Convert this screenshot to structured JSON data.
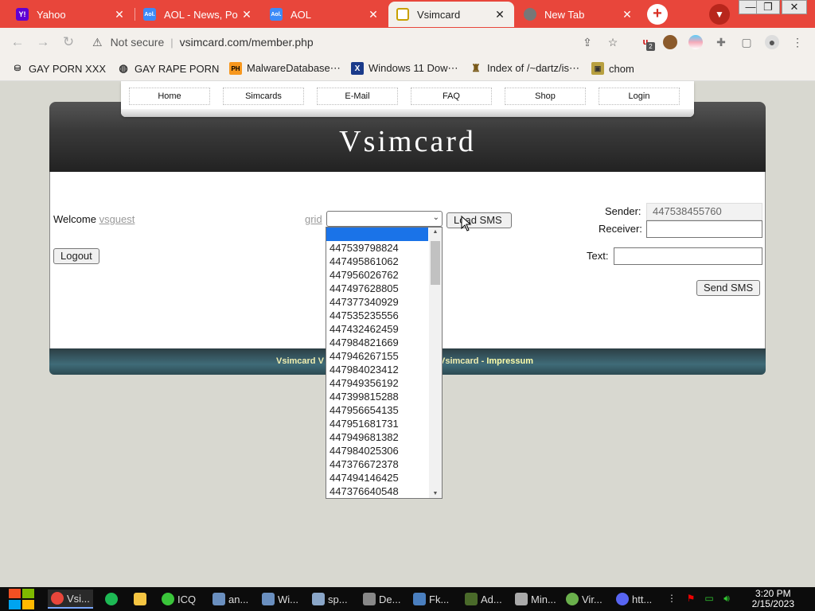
{
  "browser": {
    "tabs": [
      {
        "title": "Yahoo",
        "icon": "yahoo-favicon",
        "icon_label": "Y!",
        "color": "#6001d2"
      },
      {
        "title": "AOL - News, Po",
        "icon": "aol-favicon",
        "icon_label": "Aol.",
        "color": "#3d8af7"
      },
      {
        "title": "AOL",
        "icon": "aol-favicon",
        "icon_label": "Aol.",
        "color": "#3d8af7"
      },
      {
        "title": "Vsimcard",
        "icon": "vsimcard-favicon",
        "icon_label": "",
        "color": "#e0b000"
      },
      {
        "title": "New Tab",
        "icon": "chrome-favicon",
        "icon_label": "",
        "color": "#888888"
      }
    ],
    "new_tab_symbol": "+",
    "address": {
      "security": "Not secure",
      "separator": "|",
      "url": "vsimcard.com/member.php"
    },
    "bookmarks": [
      {
        "label": "GAY PORN XXX",
        "icon": "bookmark-icon"
      },
      {
        "label": "GAY RAPE PORN",
        "icon": "globe-icon"
      },
      {
        "label": "MalwareDatabase⋯",
        "icon": "ph-icon",
        "icon_label": "PH"
      },
      {
        "label": "Windows 11 Dow⋯",
        "icon": "x-icon",
        "icon_label": "X"
      },
      {
        "label": "Index of /~dartz/is⋯",
        "icon": "server-icon"
      },
      {
        "label": "chom",
        "icon": "image-icon"
      }
    ],
    "extension_badge": "2",
    "accent_color": "#e8463b"
  },
  "site": {
    "nav": [
      "Home",
      "Simcards",
      "E-Mail",
      "FAQ",
      "Shop",
      "Login"
    ],
    "logo": "Vsimcard",
    "welcome_label": "Welcome",
    "username": "vsguest",
    "logout_label": "Logout",
    "grid_label": "grid",
    "select_value": "",
    "load_sms_label": "Load SMS",
    "sender_label": "Sender:",
    "sender_value": "447538455760",
    "receiver_label": "Receiver:",
    "receiver_value": "",
    "text_label": "Text:",
    "text_value": "",
    "send_sms_label": "Send SMS",
    "footer_left": "Vsimcard V",
    "footer_right_prefix": "Vsimcard - ",
    "footer_impressum": "Impressum",
    "dropdown_options": [
      "",
      "447539798824",
      "447495861062",
      "447956026762",
      "447497628805",
      "447377340929",
      "447535235556",
      "447432462459",
      "447984821669",
      "447946267155",
      "447984023412",
      "447949356192",
      "447399815288",
      "447956654135",
      "447951681731",
      "447949681382",
      "447984025306",
      "447376672378",
      "447494146425",
      "447376640548"
    ]
  },
  "taskbar": {
    "items": [
      {
        "label": "Vsi...",
        "icon": "chrome-icon",
        "color": "#e8463b"
      },
      {
        "label": "",
        "icon": "spotify-icon",
        "color": "#1db954"
      },
      {
        "label": "",
        "icon": "folder-icon",
        "color": "#f5c542"
      },
      {
        "label": "ICQ",
        "icon": "icq-icon",
        "color": "#3ac53a"
      },
      {
        "label": "an...",
        "icon": "app-icon",
        "color": "#6a8fbf"
      },
      {
        "label": "Wi...",
        "icon": "app-icon",
        "color": "#6a8fbf"
      },
      {
        "label": "sp...",
        "icon": "app-icon",
        "color": "#8aa6c8"
      },
      {
        "label": "De...",
        "icon": "app-icon",
        "color": "#888888"
      },
      {
        "label": "Fk...",
        "icon": "app-icon",
        "color": "#4a7fbf"
      },
      {
        "label": "Ad...",
        "icon": "app-icon",
        "color": "#4a6a2a"
      },
      {
        "label": "Min...",
        "icon": "app-icon",
        "color": "#aaaaaa"
      },
      {
        "label": "Vir...",
        "icon": "app-icon",
        "color": "#6ab04c"
      },
      {
        "label": "htt...",
        "icon": "discord-icon",
        "color": "#5865f2"
      }
    ],
    "time": "3:20 PM",
    "date": "2/15/2023"
  }
}
